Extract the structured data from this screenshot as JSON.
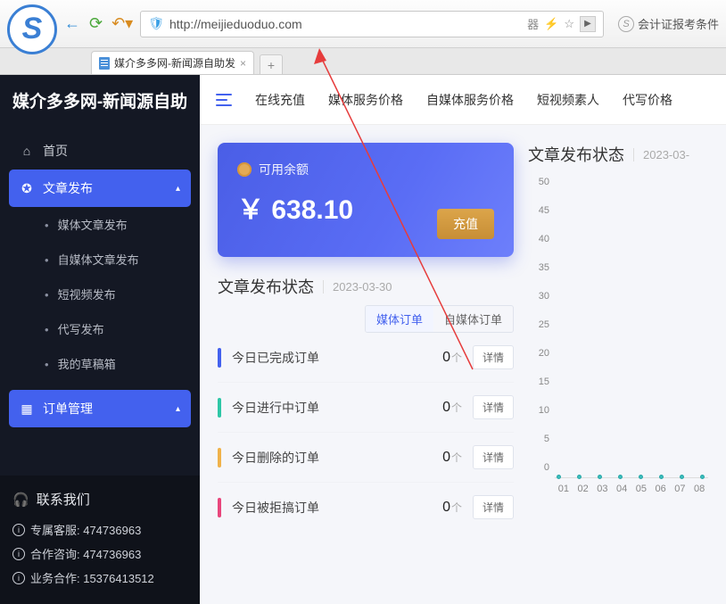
{
  "browser": {
    "url": "http://meijieduoduo.com",
    "side_text": "会计证报考条件",
    "tab_title": "媒介多多网-新闻源自助发",
    "qr_label": "器"
  },
  "sidebar": {
    "brand": "媒介多多网-新闻源自助",
    "home": "首页",
    "publish": "文章发布",
    "subs": [
      "媒体文章发布",
      "自媒体文章发布",
      "短视频发布",
      "代写发布",
      "我的草稿箱"
    ],
    "orders": "订单管理",
    "contact_h": "联系我们",
    "contacts": [
      {
        "label": "专属客服:",
        "val": "474736963"
      },
      {
        "label": "合作咨询:",
        "val": "474736963"
      },
      {
        "label": "业务合作:",
        "val": "15376413512"
      }
    ]
  },
  "topnav": [
    "在线充值",
    "媒体服务价格",
    "自媒体服务价格",
    "短视频素人",
    "代写价格"
  ],
  "balance": {
    "label": "可用余额",
    "amount": "￥ 638.10",
    "recharge": "充值"
  },
  "status": {
    "title": "文章发布状态",
    "date": "2023-03-30",
    "tabs": [
      "媒体订单",
      "自媒体订单"
    ],
    "rows": [
      {
        "color": "#4361ee",
        "label": "今日已完成订单",
        "count": "0",
        "unit": "个",
        "btn": "详情"
      },
      {
        "color": "#2ec7a6",
        "label": "今日进行中订单",
        "count": "0",
        "unit": "个",
        "btn": "详情"
      },
      {
        "color": "#f0b24a",
        "label": "今日删除的订单",
        "count": "0",
        "unit": "个",
        "btn": "详情"
      },
      {
        "color": "#e8467c",
        "label": "今日被拒搞订单",
        "count": "0",
        "unit": "个",
        "btn": "详情"
      }
    ]
  },
  "right_panel": {
    "title": "文章发布状态",
    "date": "2023-03-"
  },
  "chart_data": {
    "type": "line",
    "title": "文章发布状态",
    "x": [
      "01",
      "02",
      "03",
      "04",
      "05",
      "06",
      "07",
      "08"
    ],
    "series": [
      {
        "name": "count",
        "values": [
          0,
          0,
          0,
          0,
          0,
          0,
          0,
          0
        ]
      }
    ],
    "ylim": [
      0,
      50
    ],
    "yticks": [
      0,
      5,
      10,
      15,
      20,
      25,
      30,
      35,
      40,
      45,
      50
    ],
    "xlabel": "",
    "ylabel": ""
  }
}
